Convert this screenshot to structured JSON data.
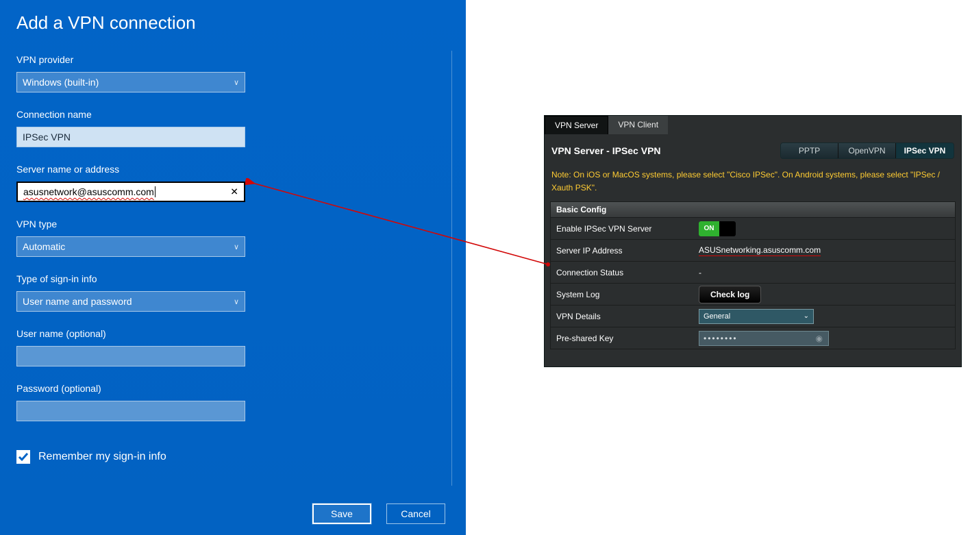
{
  "windows": {
    "title": "Add a VPN connection",
    "fields": {
      "vpn_provider": {
        "label": "VPN provider",
        "value": "Windows (built-in)"
      },
      "connection_name": {
        "label": "Connection name",
        "value": "IPSec VPN"
      },
      "server": {
        "label": "Server name or address",
        "value": "asusnetwork@asuscomm.com"
      },
      "vpn_type": {
        "label": "VPN type",
        "value": "Automatic"
      },
      "signin_type": {
        "label": "Type of sign-in info",
        "value": "User name and password"
      },
      "username": {
        "label": "User name (optional)",
        "value": ""
      },
      "password": {
        "label": "Password (optional)",
        "value": ""
      }
    },
    "remember": {
      "label": "Remember my sign-in info",
      "checked": true
    },
    "buttons": {
      "save": "Save",
      "cancel": "Cancel"
    }
  },
  "router": {
    "tabs": {
      "server": "VPN Server",
      "client": "VPN Client",
      "active": "server"
    },
    "title": "VPN Server - IPSec VPN",
    "modes": {
      "pptp": "PPTP",
      "openvpn": "OpenVPN",
      "ipsec": "IPSec VPN",
      "active": "ipsec"
    },
    "note": "Note: On iOS or MacOS systems, please select \"Cisco IPSec\". On Android systems, please select \"IPSec / Xauth PSK\".",
    "section": "Basic Config",
    "rows": {
      "enable": {
        "label": "Enable IPSec VPN Server",
        "value": "ON"
      },
      "ip": {
        "label": "Server IP Address",
        "value": "ASUSnetworking.asuscomm.com"
      },
      "status": {
        "label": "Connection Status",
        "value": "-"
      },
      "log": {
        "label": "System Log",
        "button": "Check log"
      },
      "details": {
        "label": "VPN Details",
        "value": "General"
      },
      "psk": {
        "label": "Pre-shared Key",
        "value": "••••••••"
      }
    }
  }
}
